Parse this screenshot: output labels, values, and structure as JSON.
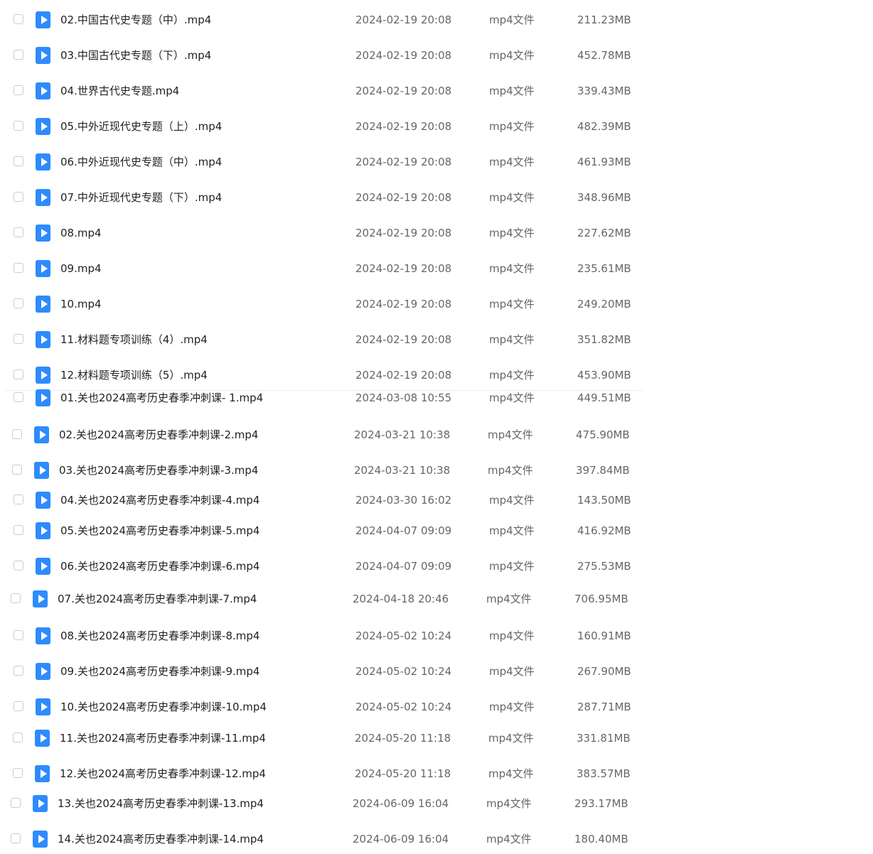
{
  "files": [
    {
      "name": "02.中国古代史专题（中）.mp4",
      "date": "2024-02-19 20:08",
      "type": "mp4文件",
      "size": "211.23MB",
      "icon": "video-file-icon"
    },
    {
      "name": "03.中国古代史专题（下）.mp4",
      "date": "2024-02-19 20:08",
      "type": "mp4文件",
      "size": "452.78MB",
      "icon": "video-file-icon"
    },
    {
      "name": "04.世界古代史专题.mp4",
      "date": "2024-02-19 20:08",
      "type": "mp4文件",
      "size": "339.43MB",
      "icon": "video-file-icon"
    },
    {
      "name": "05.中外近现代史专题（上）.mp4",
      "date": "2024-02-19 20:08",
      "type": "mp4文件",
      "size": "482.39MB",
      "icon": "video-file-icon"
    },
    {
      "name": "06.中外近现代史专题（中）.mp4",
      "date": "2024-02-19 20:08",
      "type": "mp4文件",
      "size": "461.93MB",
      "icon": "video-file-icon"
    },
    {
      "name": "07.中外近现代史专题（下）.mp4",
      "date": "2024-02-19 20:08",
      "type": "mp4文件",
      "size": "348.96MB",
      "icon": "video-file-icon"
    },
    {
      "name": "08.mp4",
      "date": "2024-02-19 20:08",
      "type": "mp4文件",
      "size": "227.62MB",
      "icon": "video-file-icon"
    },
    {
      "name": "09.mp4",
      "date": "2024-02-19 20:08",
      "type": "mp4文件",
      "size": "235.61MB",
      "icon": "video-file-icon"
    },
    {
      "name": "10.mp4",
      "date": "2024-02-19 20:08",
      "type": "mp4文件",
      "size": "249.20MB",
      "icon": "video-file-icon"
    },
    {
      "name": "11.材料题专项训练（4）.mp4",
      "date": "2024-02-19 20:08",
      "type": "mp4文件",
      "size": "351.82MB",
      "icon": "video-file-icon"
    },
    {
      "name": "12.材料题专项训练（5）.mp4",
      "date": "2024-02-19 20:08",
      "type": "mp4文件",
      "size": "453.90MB",
      "icon": "video-file-icon"
    },
    {
      "name": "01.关也2024高考历史春季冲刺课- 1.mp4",
      "date": "2024-03-08 10:55",
      "type": "mp4文件",
      "size": "449.51MB",
      "icon": "video-file-icon"
    },
    {
      "name": "02.关也2024高考历史春季冲刺课-2.mp4",
      "date": "2024-03-21 10:38",
      "type": "mp4文件",
      "size": "475.90MB",
      "icon": "video-file-icon"
    },
    {
      "name": "03.关也2024高考历史春季冲刺课-3.mp4",
      "date": "2024-03-21 10:38",
      "type": "mp4文件",
      "size": "397.84MB",
      "icon": "video-file-icon"
    },
    {
      "name": "04.关也2024高考历史春季冲刺课-4.mp4",
      "date": "2024-03-30 16:02",
      "type": "mp4文件",
      "size": "143.50MB",
      "icon": "video-file-icon"
    },
    {
      "name": "05.关也2024高考历史春季冲刺课-5.mp4",
      "date": "2024-04-07 09:09",
      "type": "mp4文件",
      "size": "416.92MB",
      "icon": "video-file-icon"
    },
    {
      "name": "06.关也2024高考历史春季冲刺课-6.mp4",
      "date": "2024-04-07 09:09",
      "type": "mp4文件",
      "size": "275.53MB",
      "icon": "video-file-icon"
    },
    {
      "name": "07.关也2024高考历史春季冲刺课-7.mp4",
      "date": "2024-04-18 20:46",
      "type": "mp4文件",
      "size": "706.95MB",
      "icon": "video-file-icon"
    },
    {
      "name": "08.关也2024高考历史春季冲刺课-8.mp4",
      "date": "2024-05-02 10:24",
      "type": "mp4文件",
      "size": "160.91MB",
      "icon": "video-file-icon"
    },
    {
      "name": "09.关也2024高考历史春季冲刺课-9.mp4",
      "date": "2024-05-02 10:24",
      "type": "mp4文件",
      "size": "267.90MB",
      "icon": "video-file-icon"
    },
    {
      "name": "10.关也2024高考历史春季冲刺课-10.mp4",
      "date": "2024-05-02 10:24",
      "type": "mp4文件",
      "size": "287.71MB",
      "icon": "video-file-icon"
    },
    {
      "name": "11.关也2024高考历史春季冲刺课-11.mp4",
      "date": "2024-05-20 11:18",
      "type": "mp4文件",
      "size": "331.81MB",
      "icon": "video-file-icon"
    },
    {
      "name": "12.关也2024高考历史春季冲刺课-12.mp4",
      "date": "2024-05-20 11:18",
      "type": "mp4文件",
      "size": "383.57MB",
      "icon": "video-file-icon"
    },
    {
      "name": "13.关也2024高考历史春季冲刺课-13.mp4",
      "date": "2024-06-09 16:04",
      "type": "mp4文件",
      "size": "293.17MB",
      "icon": "video-file-icon"
    },
    {
      "name": "14.关也2024高考历史春季冲刺课-14.mp4",
      "date": "2024-06-09 16:04",
      "type": "mp4文件",
      "size": "180.40MB",
      "icon": "video-file-icon"
    }
  ]
}
